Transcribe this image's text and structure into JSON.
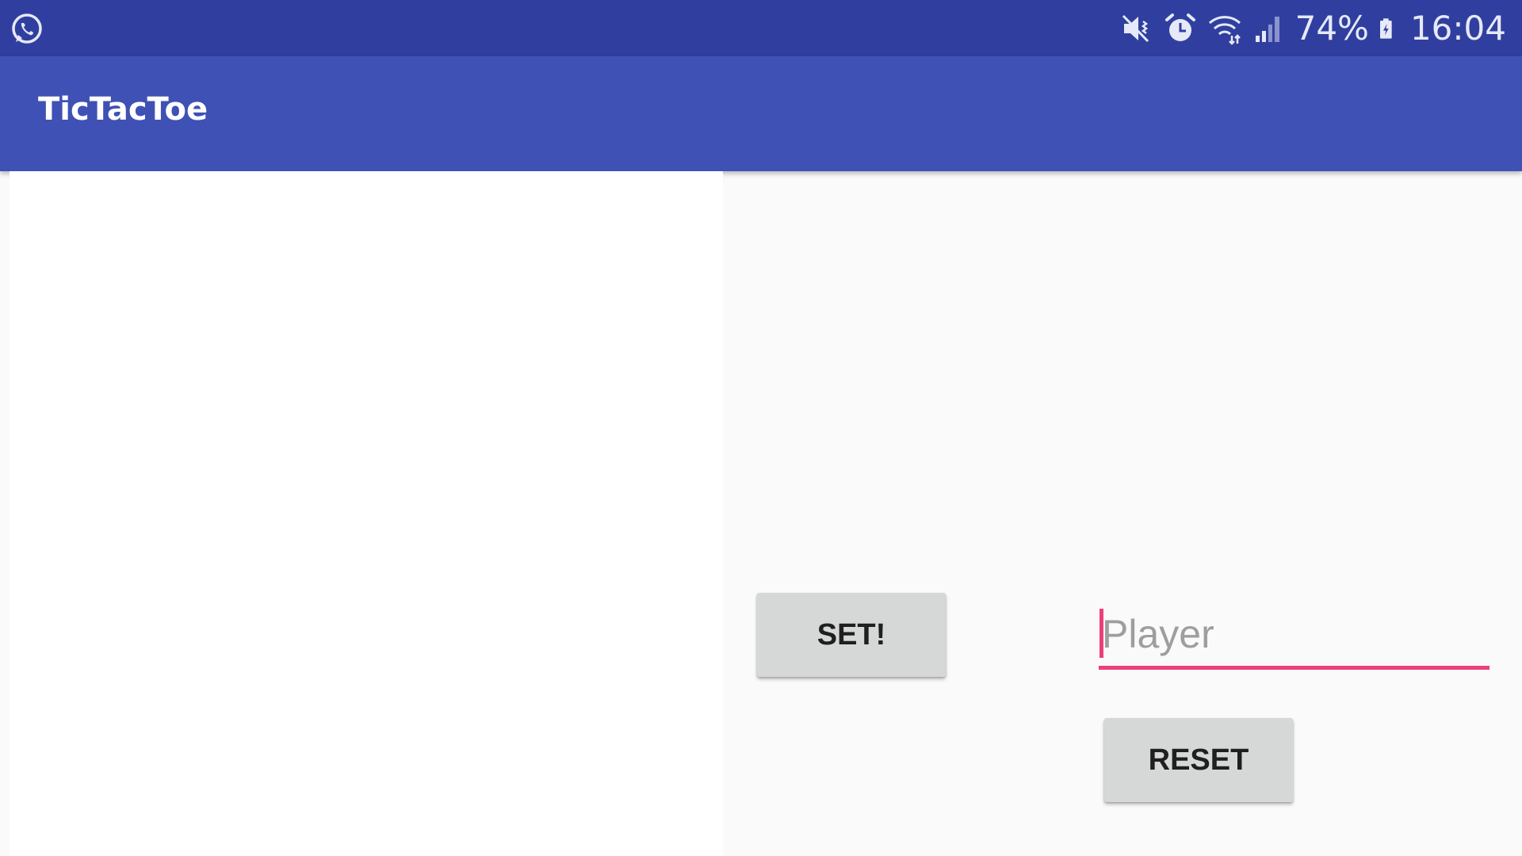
{
  "status_bar": {
    "left_icon": "whatsapp-icon",
    "icons": [
      "mute-icon",
      "alarm-icon",
      "wifi-icon",
      "signal-icon",
      "battery-charging-icon"
    ],
    "battery": "74%",
    "time": "16:04",
    "color": "#303f9f"
  },
  "app_bar": {
    "title": "TicTacToe",
    "color": "#3f51b5"
  },
  "controls": {
    "set_label": "SET!",
    "reset_label": "RESET",
    "player_input": {
      "value": "",
      "placeholder": "Player",
      "accent": "#ec407a"
    }
  }
}
